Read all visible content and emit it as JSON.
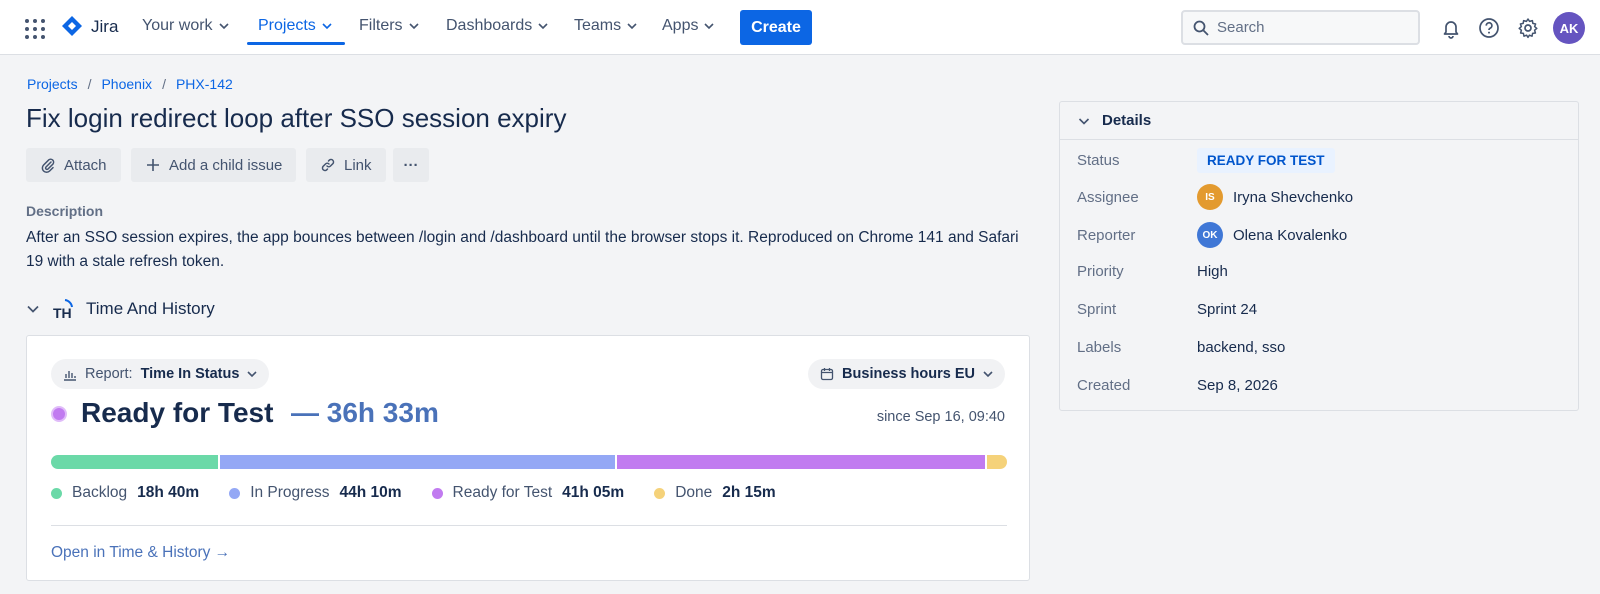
{
  "nav": {
    "product": "Jira",
    "items": [
      {
        "label": "Your work"
      },
      {
        "label": "Projects"
      },
      {
        "label": "Filters"
      },
      {
        "label": "Dashboards"
      },
      {
        "label": "Teams"
      },
      {
        "label": "Apps"
      }
    ],
    "active_item": "Projects",
    "create_label": "Create",
    "search_placeholder": "Search",
    "avatar_initials": "AK",
    "brand_color": "#0c66e4"
  },
  "breadcrumb": [
    "Projects",
    "Phoenix",
    "PHX-142"
  ],
  "issue": {
    "title": "Fix login redirect loop after SSO session expiry",
    "actions": {
      "attach": "Attach",
      "child": "Add a child issue",
      "link": "Link",
      "more": "···"
    },
    "description_label": "Description",
    "description": "After an SSO session expires, the app bounces between /login and /dashboard until the browser stops it. Reproduced on Chrome 141 and Safari 19 with a stale refresh token."
  },
  "time_history": {
    "section_title": "Time And History",
    "logo_text": "TH",
    "report_prefix": "Report:",
    "report_name": "Time In Status",
    "hours_option": "Business hours EU",
    "current_status": "Ready for Test",
    "current_duration": "— 36h 33m",
    "since": "since Sep 16, 09:40",
    "statuses": [
      {
        "name": "Backlog",
        "duration": "18h 40m",
        "hours": 18.67,
        "color": "#6bd9a8"
      },
      {
        "name": "In Progress",
        "duration": "44h 10m",
        "hours": 44.17,
        "color": "#94a8f5"
      },
      {
        "name": "Ready for Test",
        "duration": "41h 05m",
        "hours": 41.08,
        "color": "#c17bf0"
      },
      {
        "name": "Done",
        "duration": "2h 15m",
        "hours": 2.25,
        "color": "#f5d27a"
      }
    ],
    "open_link": "Open in Time & History →"
  },
  "details": {
    "header": "Details",
    "status_label": "Status",
    "status_value": "READY FOR TEST",
    "assignee_label": "Assignee",
    "assignee_initials": "IS",
    "assignee_color": "#e39a2f",
    "assignee_name": "Iryna Shevchenko",
    "reporter_label": "Reporter",
    "reporter_initials": "OK",
    "reporter_color": "#3f77d6",
    "reporter_name": "Olena Kovalenko",
    "priority_label": "Priority",
    "priority_value": "High",
    "sprint_label": "Sprint",
    "sprint_value": "Sprint 24",
    "labels_label": "Labels",
    "labels_value": "backend, sso",
    "created_label": "Created",
    "created_value": "Sep 8, 2026"
  }
}
